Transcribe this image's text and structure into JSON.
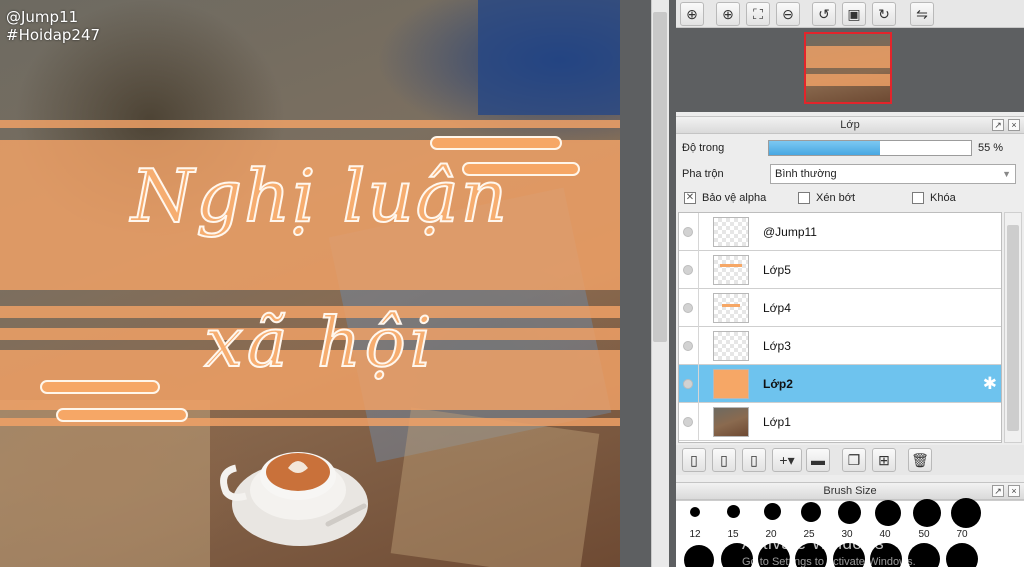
{
  "canvas": {
    "watermark_line1": "@Jump11",
    "watermark_line2": "#Hoidap247",
    "title": "Nghị luận",
    "subtitle": "xã hội"
  },
  "navigator": {
    "buttons": [
      "zoom-actual-icon",
      "zoom-in-icon",
      "fit-screen-icon",
      "zoom-out-icon",
      "rotate-left-icon",
      "fit-window-icon",
      "rotate-right-icon",
      "flip-icon"
    ]
  },
  "layers_panel": {
    "title": "Lớp",
    "opacity_label": "Độ trong",
    "opacity_value": "55 %",
    "opacity_fraction": 0.55,
    "blend_label": "Pha trộn",
    "blend_value": "Bình thường",
    "protect_alpha": "Bảo vệ alpha",
    "clipping": "Xén bớt",
    "lock": "Khóa",
    "layers": [
      {
        "name": "@Jump11",
        "selected": false
      },
      {
        "name": "Lớp5",
        "selected": false
      },
      {
        "name": "Lớp4",
        "selected": false
      },
      {
        "name": "Lớp3",
        "selected": false
      },
      {
        "name": "Lớp2",
        "selected": true
      },
      {
        "name": "Lớp1",
        "selected": false
      }
    ]
  },
  "brush_size_panel": {
    "title": "Brush Size",
    "sizes": [
      "12",
      "15",
      "20",
      "25",
      "30",
      "40",
      "50",
      "70"
    ]
  },
  "os_watermark": {
    "line1": "Activate Windows",
    "line2": "Go to Settings to activate Windows."
  },
  "colors": {
    "accent_orange": "#f6a766",
    "selection_blue": "#6ec3ee",
    "opacity_fill": "#47a7e2"
  }
}
